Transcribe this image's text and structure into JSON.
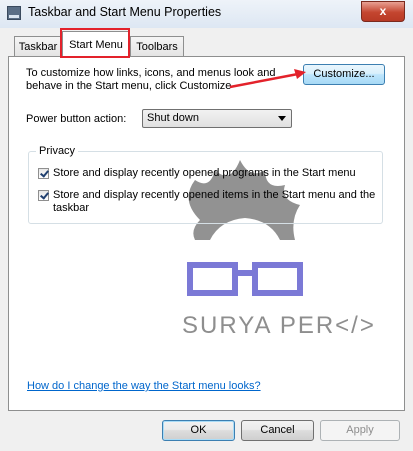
{
  "window": {
    "title": "Taskbar and Start Menu Properties",
    "close_label": "x"
  },
  "tabs": [
    {
      "label": "Taskbar",
      "active": false
    },
    {
      "label": "Start Menu",
      "active": true
    },
    {
      "label": "Toolbars",
      "active": false
    }
  ],
  "start_menu": {
    "description": "To customize how links, icons, and menus look and behave in the Start menu, click Customize",
    "customize_label": "Customize...",
    "power_label": "Power button action:",
    "power_value": "Shut down"
  },
  "privacy": {
    "title": "Privacy",
    "items": [
      {
        "label": "Store and display recently opened programs in the Start menu",
        "checked": true
      },
      {
        "label": "Store and display recently opened items in the Start menu and the taskbar",
        "checked": true
      }
    ]
  },
  "watermark": {
    "text": "SURYA PER</>"
  },
  "help_link": "How do I change the way the Start menu looks?",
  "footer": {
    "ok": "OK",
    "cancel": "Cancel",
    "apply": "Apply"
  },
  "colors": {
    "highlight": "#e3222b",
    "link": "#0066cc",
    "accent": "#3c7fb1"
  },
  "icons": [
    "window-icon",
    "close-icon",
    "chevron-down-icon",
    "checkbox-check-icon",
    "red-arrow-annotation"
  ]
}
